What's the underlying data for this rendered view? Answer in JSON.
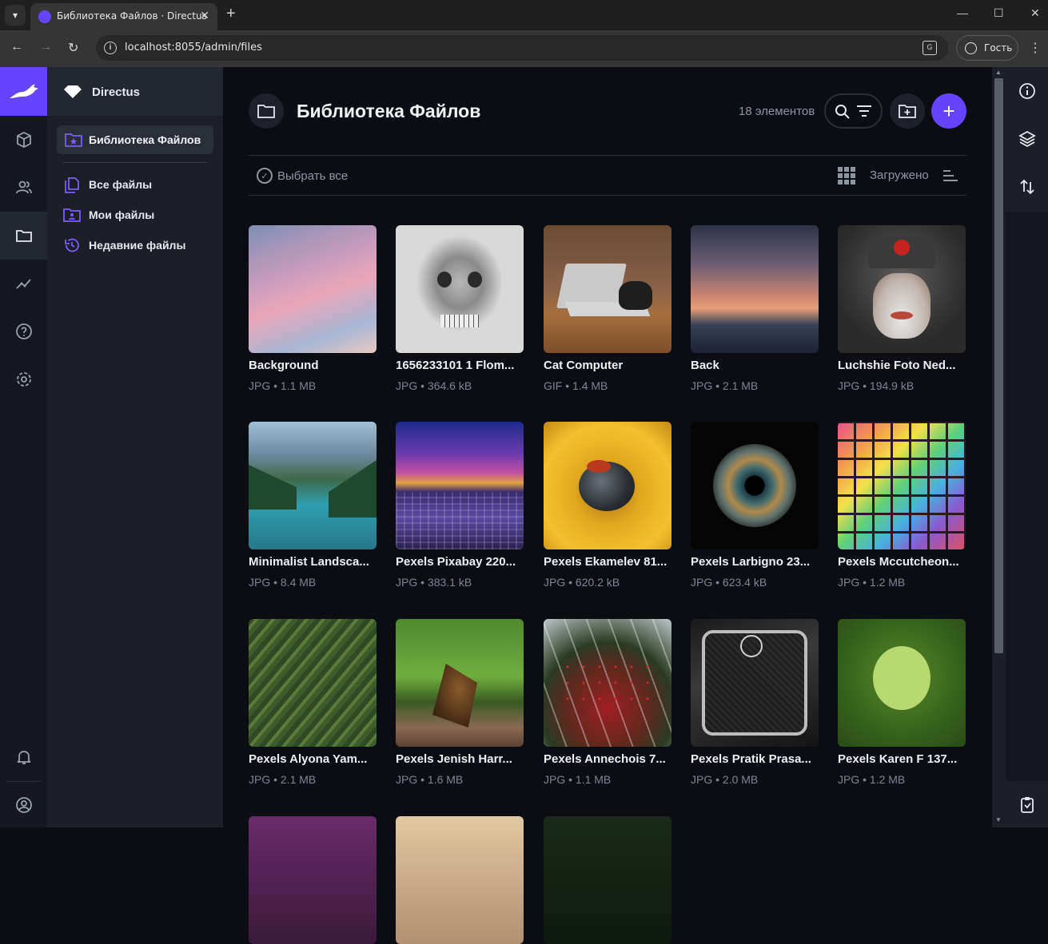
{
  "browser": {
    "tab_title": "Библиотека Файлов · Directus",
    "url": "localhost:8055/admin/files",
    "profile_label": "Гость"
  },
  "nav": {
    "project_name": "Directus",
    "active_label": "Библиотека Файлов",
    "links": [
      {
        "label": "Все файлы",
        "icon": "files-icon"
      },
      {
        "label": "Мои файлы",
        "icon": "user-folder-icon"
      },
      {
        "label": "Недавние файлы",
        "icon": "history-icon"
      }
    ]
  },
  "header": {
    "title": "Библиотека Файлов",
    "item_count": "18 элементов"
  },
  "toolbar": {
    "select_all": "Выбрать все",
    "sort_label": "Загружено"
  },
  "rail": {
    "icons": [
      "content-icon",
      "users-icon",
      "files-icon",
      "insights-icon",
      "help-icon",
      "settings-icon",
      "notifications-icon",
      "account-icon"
    ]
  },
  "sidebar": {
    "icons": [
      "info-icon",
      "layers-icon",
      "import-export-icon",
      "clipboard-icon"
    ]
  },
  "colors": {
    "accent": "#6644ff",
    "background": "#0b0d12"
  },
  "files": [
    {
      "title": "Background",
      "meta": "JPG • 1.1 MB"
    },
    {
      "title": "1656233101 1 Flom...",
      "meta": "JPG • 364.6 kB"
    },
    {
      "title": "Cat Computer",
      "meta": "GIF • 1.4 MB"
    },
    {
      "title": "Back",
      "meta": "JPG • 2.1 MB"
    },
    {
      "title": "Luchshie Foto Ned...",
      "meta": "JPG • 194.9 kB"
    },
    {
      "title": "Minimalist Landsca...",
      "meta": "JPG • 8.4 MB"
    },
    {
      "title": "Pexels Pixabay 220...",
      "meta": "JPG • 383.1 kB"
    },
    {
      "title": "Pexels Ekamelev 81...",
      "meta": "JPG • 620.2 kB"
    },
    {
      "title": "Pexels Larbigno 23...",
      "meta": "JPG • 623.4 kB"
    },
    {
      "title": "Pexels Mccutcheon...",
      "meta": "JPG • 1.2 MB"
    },
    {
      "title": "Pexels Alyona Yam...",
      "meta": "JPG • 2.1 MB"
    },
    {
      "title": "Pexels Jenish Harr...",
      "meta": "JPG • 1.6 MB"
    },
    {
      "title": "Pexels Annechois 7...",
      "meta": "JPG • 1.1 MB"
    },
    {
      "title": "Pexels Pratik Prasa...",
      "meta": "JPG • 2.0 MB"
    },
    {
      "title": "Pexels Karen F 137...",
      "meta": "JPG • 1.2 MB"
    }
  ]
}
